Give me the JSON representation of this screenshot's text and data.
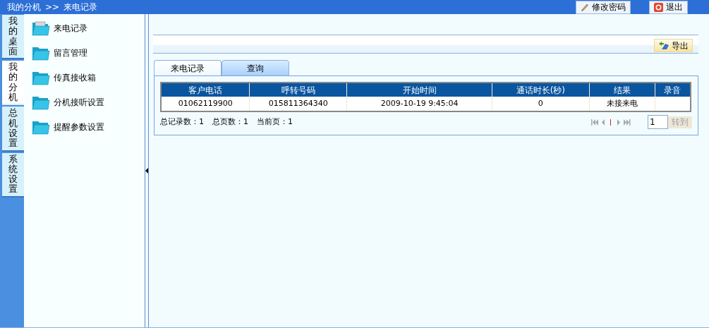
{
  "breadcrumb": {
    "parts": [
      "我的分机",
      ">>",
      "来电记录"
    ]
  },
  "header_buttons": [
    {
      "kind": "pencil",
      "label": "修改密码"
    },
    {
      "kind": "power",
      "label": "退出"
    }
  ],
  "vertical_tabs": [
    {
      "label": "我的桌面",
      "selected": false
    },
    {
      "label": "我的分机",
      "selected": true
    },
    {
      "label": "总机设置",
      "selected": false
    },
    {
      "label": "系统设置",
      "selected": false
    }
  ],
  "sidebar": {
    "items": [
      {
        "label": "来电记录",
        "selected": true
      },
      {
        "label": "留言管理",
        "selected": false
      },
      {
        "label": "传真接收箱",
        "selected": false
      },
      {
        "label": "分机接听设置",
        "selected": false
      },
      {
        "label": "提醒参数设置",
        "selected": false
      }
    ]
  },
  "toolbar": {
    "export_button": "导出"
  },
  "tabs": [
    {
      "label": "来电记录",
      "selected": true
    },
    {
      "label": "查询",
      "selected": false
    }
  ],
  "table": {
    "columns": [
      "客户电话",
      "呼转号码",
      "开始时间",
      "通话时长(秒)",
      "结果",
      "录音"
    ],
    "rows": [
      [
        "01062119900",
        "015811364340",
        "2009-10-19 9:45:04",
        "0",
        "未接来电",
        ""
      ]
    ]
  },
  "pager": {
    "stats": [
      "总记录数：1",
      "总页数：1",
      "当前页：1"
    ],
    "page_input": "1",
    "go_button": "转到"
  }
}
